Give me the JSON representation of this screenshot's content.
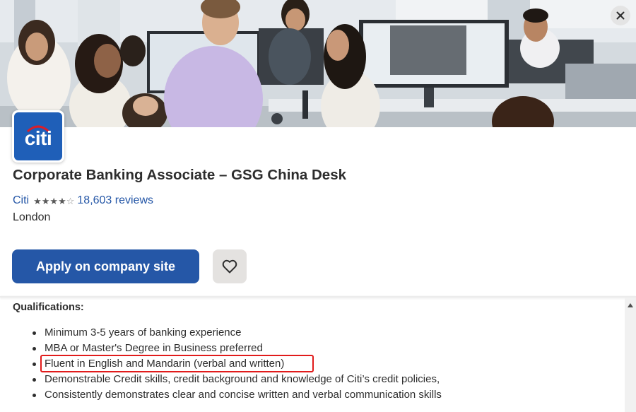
{
  "header": {
    "close_label": "×",
    "logo_text": "citi",
    "job_title": "Corporate Banking Associate – GSG China Desk",
    "company_name": "Citi",
    "rating": 4,
    "rating_max": 5,
    "reviews_text": "18,603 reviews",
    "location": "London",
    "apply_label": "Apply on company site",
    "save_icon": "heart-icon"
  },
  "description": {
    "heading": "Qualifications:",
    "items": [
      "Minimum 3-5 years of banking experience",
      "MBA or Master's Degree in Business preferred",
      "Fluent in English and Mandarin (verbal and written)",
      "Demonstrable Credit skills, credit background and knowledge of Citi’s credit policies,",
      "Consistently demonstrates clear and concise written and verbal communication skills"
    ],
    "highlighted_item_index": 2
  },
  "colors": {
    "brand_blue": "#2557a7",
    "citi_logo_blue": "#1f5fb8",
    "citi_logo_arc": "#d81e2a",
    "highlight_red": "#e11b1b"
  }
}
